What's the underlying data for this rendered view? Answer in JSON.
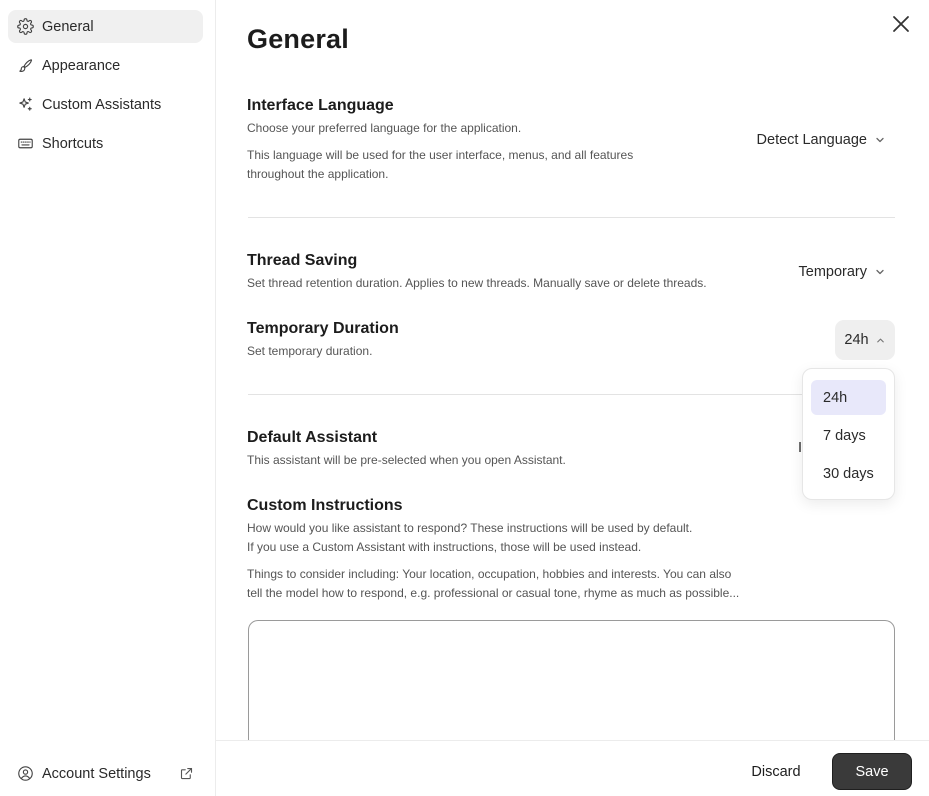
{
  "sidebar": {
    "items": [
      {
        "label": "General",
        "icon": "gear-icon",
        "active": true
      },
      {
        "label": "Appearance",
        "icon": "brush-icon",
        "active": false
      },
      {
        "label": "Custom Assistants",
        "icon": "sparkles-icon",
        "active": false
      },
      {
        "label": "Shortcuts",
        "icon": "keyboard-icon",
        "active": false
      }
    ],
    "account_label": "Account Settings"
  },
  "page": {
    "title": "General"
  },
  "language": {
    "title": "Interface Language",
    "desc1": "Choose your preferred language for the application.",
    "desc2_line1": "This language will be used for the user interface, menus, and all features",
    "desc2_line2": "throughout the application.",
    "value": "Detect Language"
  },
  "thread": {
    "title": "Thread Saving",
    "desc": "Set thread retention duration. Applies to new threads. Manually save or delete threads.",
    "value": "Temporary"
  },
  "duration": {
    "title": "Temporary Duration",
    "desc": "Set temporary duration.",
    "value": "24h",
    "options": [
      "24h",
      "7 days",
      "30 days"
    ],
    "selected_index": 0
  },
  "assistant": {
    "title": "Default Assistant",
    "desc": "This assistant will be pre-selected when you open Assistant.",
    "value_partial": "I"
  },
  "instructions": {
    "title": "Custom Instructions",
    "desc_line1": "How would you like assistant to respond? These instructions will be used by default.",
    "desc_line2": "If you use a Custom Assistant with instructions, those will be used instead.",
    "hint_line1": "Things to consider including: Your location, occupation, hobbies and interests. You can also",
    "hint_line2": "tell the model how to respond, e.g. professional or casual tone, rhyme as much as possible...",
    "value": ""
  },
  "footer": {
    "discard_label": "Discard",
    "save_label": "Save"
  },
  "colors": {
    "accent_selected": "#e8e8fa",
    "save_bg": "#3a3a3a"
  }
}
